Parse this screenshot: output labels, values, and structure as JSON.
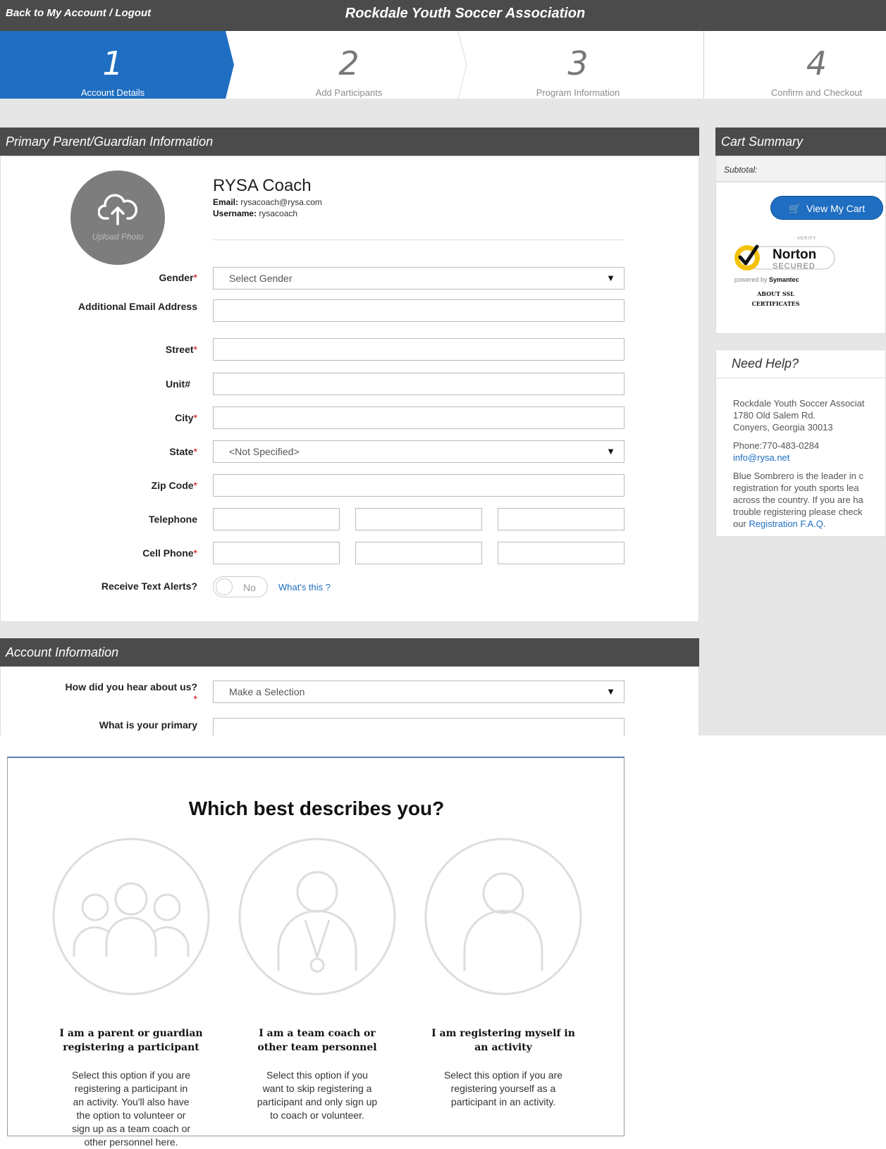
{
  "topbar": {
    "back_link": "Back to My Account / Logout",
    "title": "Rockdale Youth Soccer Association"
  },
  "steps": [
    {
      "num": "1",
      "label": "Account Details",
      "active": true
    },
    {
      "num": "2",
      "label": "Add Participants",
      "active": false
    },
    {
      "num": "3",
      "label": "Program Information",
      "active": false
    },
    {
      "num": "4",
      "label": "Confirm and Checkout",
      "active": false
    }
  ],
  "primary": {
    "heading": "Primary Parent/Guardian Information",
    "upload_label": "Upload Photo",
    "name": "RYSA Coach",
    "email_label": "Email:",
    "email": "rysacoach@rysa.com",
    "username_label": "Username:",
    "username": "rysacoach",
    "fields": {
      "gender": "Gender",
      "gender_value": "Select Gender",
      "additional_email": "Additional Email Address",
      "street": "Street",
      "unit": "Unit#",
      "city": "City",
      "state": "State",
      "state_value": "<Not Specified>",
      "zip": "Zip Code",
      "telephone": "Telephone",
      "cell_phone": "Cell Phone",
      "text_alerts": "Receive Text Alerts?",
      "text_alerts_value": "No",
      "whats_this": "What's this ?"
    },
    "required_mark": "*"
  },
  "account": {
    "heading": "Account Information",
    "hear_label": "How did you hear about us?",
    "hear_value": "Make a Selection",
    "primary_label": "What is your primary"
  },
  "cart": {
    "heading": "Cart Summary",
    "subtotal": "Subtotal:",
    "view_cart": "View My Cart",
    "norton_verify": "VERIFY",
    "norton_name": "Norton",
    "norton_secured": "SECURED",
    "norton_powered": "powered by",
    "norton_symantec": "Symantec",
    "ssl_1": "ABOUT SSL",
    "ssl_2": "CERTIFICATES"
  },
  "help": {
    "heading": "Need Help?",
    "org": "Rockdale Youth Soccer Associat",
    "address1": "1780 Old Salem Rd.",
    "address2": "Conyers, Georgia 30013",
    "phone": "Phone:770-483-0284",
    "email": "info@rysa.net",
    "blurb1": "Blue Sombrero is the leader in c",
    "blurb2": "registration for youth sports lea",
    "blurb3": "across the country. If you are ha",
    "blurb4": "trouble registering please check",
    "blurb5_prefix": "our",
    "faq_link": "Registration F.A.Q."
  },
  "dialog": {
    "question": "Which best describes you?",
    "options": [
      {
        "title1": "I am a parent or guardian",
        "title2": "registering a participant",
        "desc": [
          "Select this option if you are",
          "registering a participant in",
          "an activity. You'll also have",
          "the option to volunteer or",
          "sign up as a team coach or",
          "other personnel here."
        ]
      },
      {
        "title1": "I am a team coach or",
        "title2": "other team personnel",
        "desc": [
          "Select this option if you",
          "want to skip registering a",
          "participant and only sign up",
          "to coach or volunteer."
        ]
      },
      {
        "title1": "I am registering myself in",
        "title2": "an activity",
        "desc": [
          "Select this option if you are",
          "registering yourself as a",
          "participant in an activity."
        ]
      }
    ]
  },
  "colors": {
    "accent": "#1f6ec2",
    "header": "#4b4b4b",
    "required": "#cc0000"
  }
}
